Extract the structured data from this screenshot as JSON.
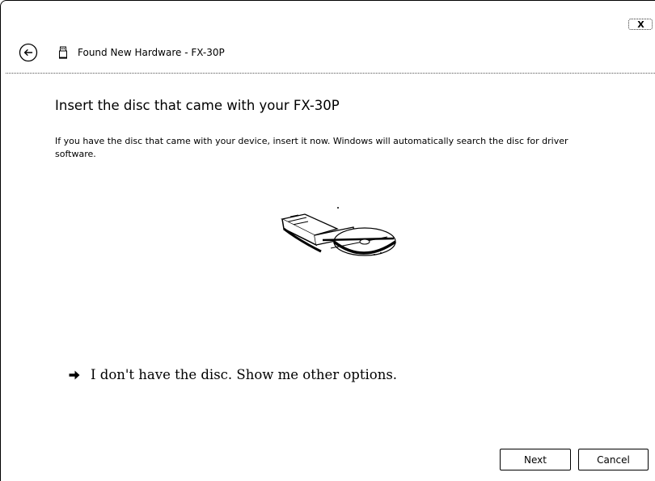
{
  "window": {
    "title": "Found New Hardware - FX-30P",
    "close_label": "X",
    "back_icon": "back-arrow-icon",
    "hardware_icon": "usb-device-icon"
  },
  "main": {
    "heading": "Insert the disc that came with your FX-30P",
    "description": "If you have the disc that came with your device, insert it now.  Windows will automatically search the disc for driver software.",
    "illustration": "disc-drive-icon",
    "option_link": "I don't have the disc.  Show me other options."
  },
  "buttons": {
    "next": "Next",
    "cancel": "Cancel"
  }
}
